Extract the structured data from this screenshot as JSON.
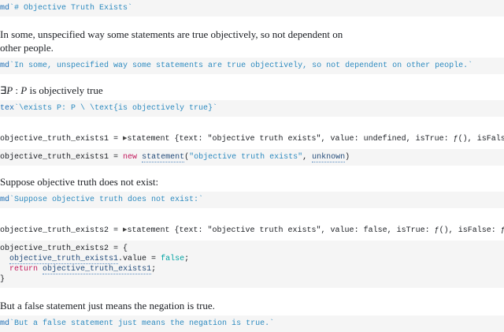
{
  "cells": [
    {
      "id": "c1",
      "type": "code",
      "tag": "md",
      "src": "`# Objective Truth Exists`"
    },
    {
      "id": "c2",
      "type": "prose",
      "text": "In some, unspecified way some statements are true objectively, so not dependent on",
      "text2": "other people."
    },
    {
      "id": "c3",
      "type": "code",
      "tag": "md",
      "src": "`In some, unspecified way some statements are true objectively, so not dependent on other people.`"
    },
    {
      "id": "c4",
      "type": "math",
      "exists": "∃",
      "var": "P",
      "colon": " : ",
      "var2": "P",
      "rest": " is objectively true"
    },
    {
      "id": "c5",
      "type": "code",
      "tag": "tex",
      "src": "`\\exists P: P \\ \\text{is objectively true}`"
    },
    {
      "id": "c6",
      "type": "output",
      "name": "objective_truth_exists1",
      "eq": " = ",
      "kind": "statement",
      "open": " {",
      "k_text": "text",
      "v_text": "\"objective truth exists\"",
      "k_value": "value",
      "v_value1": "undefined",
      "k_isTrue": "isTrue",
      "k_isFalse": "isFalse",
      "fn": "ƒ",
      "parens": "()"
    },
    {
      "id": "c7",
      "type": "code",
      "name": "objective_truth_exists1",
      "eq": " = ",
      "new": "new",
      "ctor": "statement",
      "arg1": "\"objective truth exists\"",
      "arg2": "unknown"
    },
    {
      "id": "c8",
      "type": "prose",
      "text": "Suppose objective truth does not exist:"
    },
    {
      "id": "c9",
      "type": "code",
      "tag": "md",
      "src": "`Suppose objective truth does not exist:`"
    },
    {
      "id": "c10",
      "type": "output",
      "name": "objective_truth_exists2",
      "v_value2": "false"
    },
    {
      "id": "c11",
      "type": "code",
      "name": "objective_truth_exists2",
      "open": " = {",
      "line2_ref": "objective_truth_exists1",
      "line2_rest": ".value = ",
      "line2_val": "false",
      "ret": "return",
      "ret_ref": "objective_truth_exists1",
      "close": "}"
    },
    {
      "id": "c12",
      "type": "prose",
      "text": "But a false statement just means the negation is true."
    },
    {
      "id": "c13",
      "type": "code",
      "tag": "md",
      "src": "`But a false statement just means the negation is true.`"
    }
  ]
}
